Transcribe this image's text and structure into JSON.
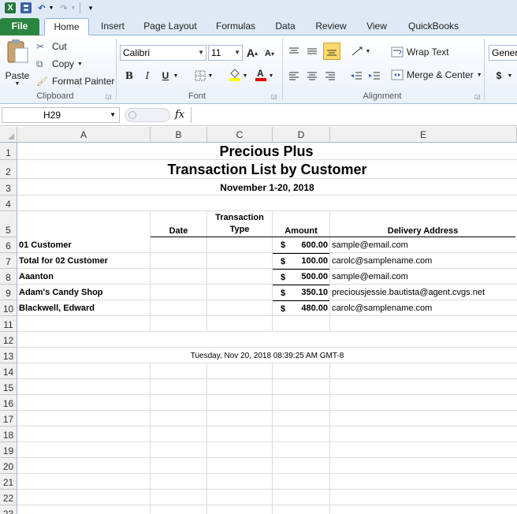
{
  "app": {
    "qat_logo": "X",
    "undo": "↶",
    "redo": "↷"
  },
  "tabs": [
    "File",
    "Home",
    "Insert",
    "Page Layout",
    "Formulas",
    "Data",
    "Review",
    "View",
    "QuickBooks"
  ],
  "clipboard": {
    "paste": "Paste",
    "cut": "Cut",
    "copy": "Copy",
    "format_painter": "Format Painter",
    "group": "Clipboard"
  },
  "font": {
    "name": "Calibri",
    "size": "11",
    "group": "Font",
    "grow": "A",
    "shrink": "A",
    "bold": "B",
    "italic": "I",
    "underline": "U"
  },
  "alignment": {
    "wrap_text": "Wrap Text",
    "merge_center": "Merge & Center",
    "group": "Alignment"
  },
  "number": {
    "format": "Gener",
    "currency": "$"
  },
  "formula_bar": {
    "name_box": "H29",
    "fx": "fx",
    "value": ""
  },
  "sheet": {
    "columns": [
      "A",
      "B",
      "C",
      "D",
      "E"
    ],
    "rows": [
      "1",
      "2",
      "3",
      "4",
      "5",
      "6",
      "7",
      "8",
      "9",
      "10",
      "11",
      "12",
      "13",
      "14",
      "15",
      "16",
      "17",
      "18",
      "19",
      "20",
      "21",
      "22",
      "23"
    ],
    "title": "Precious Plus",
    "subtitle": "Transaction List by  Customer",
    "date_range": "November 1-20, 2018",
    "headers": {
      "date": "Date",
      "type_line1": "Transaction",
      "type_line2": "Type",
      "amount": "Amount",
      "address": "Delivery Address"
    },
    "data_rows": [
      {
        "customer": "01 Customer",
        "cur": "$",
        "amount": "600.00",
        "address": "sample@email.com"
      },
      {
        "customer": "Total for 02 Customer",
        "cur": "$",
        "amount": "100.00",
        "address": "carolc@samplename.com"
      },
      {
        "customer": "Aaanton",
        "cur": "$",
        "amount": "500.00",
        "address": "sample@email.com"
      },
      {
        "customer": "Adam's Candy Shop",
        "cur": "$",
        "amount": "350.10",
        "address": "preciousjessie.bautista@agent.cvgs.net"
      },
      {
        "customer": "Blackwell, Edward",
        "cur": "$",
        "amount": "480.00",
        "address": "carolc@samplename.com"
      }
    ],
    "timestamp": "Tuesday, Nov 20, 2018 08:39:25 AM GMT-8"
  }
}
